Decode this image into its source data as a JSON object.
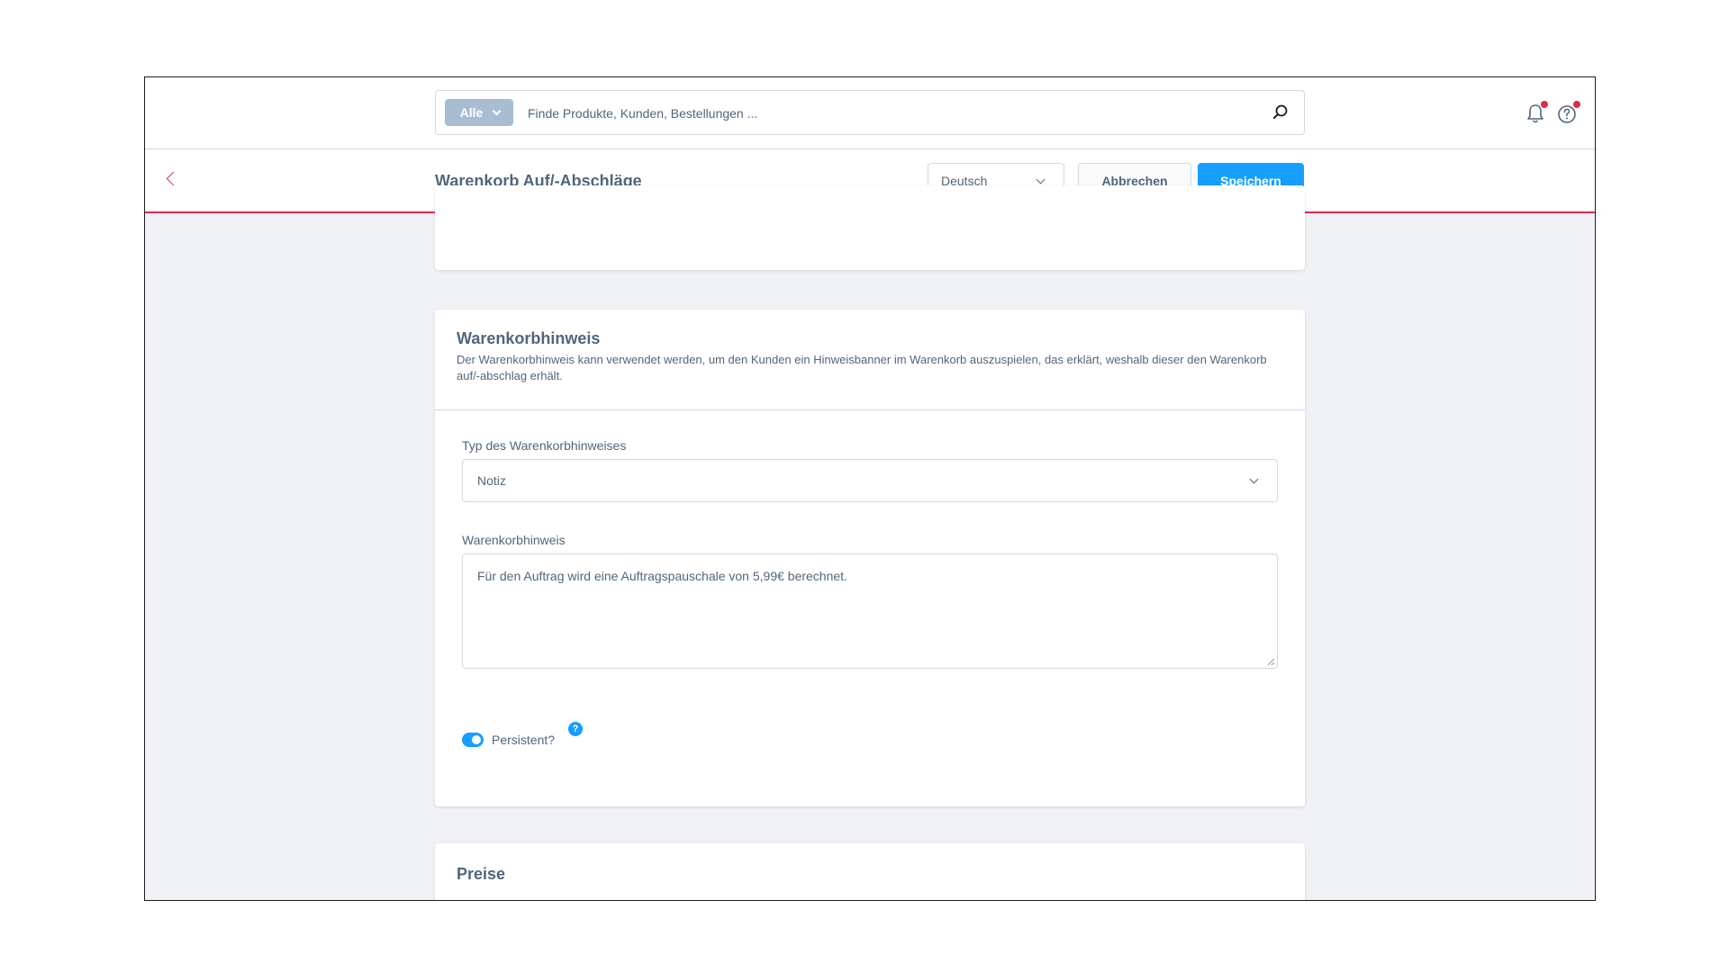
{
  "search": {
    "type_label": "Alle",
    "placeholder": "Finde Produkte, Kunden, Bestellungen ..."
  },
  "header": {
    "title": "Warenkorb Auf/-Abschläge",
    "language": "Deutsch",
    "cancel_label": "Abbrechen",
    "save_label": "Speichern"
  },
  "cart_notice": {
    "title": "Warenkorbhinweis",
    "description": "Der Warenkorbhinweis kann verwendet werden, um den Kunden ein Hinweisbanner im Warenkorb auszuspielen, das erklärt, weshalb dieser den Warenkorb auf/-abschlag erhält.",
    "type_label": "Typ des Warenkorbhinweises",
    "type_value": "Notiz",
    "notice_label": "Warenkorbhinweis",
    "notice_value": "Für den Auftrag wird eine Auftragspauschale von 5,99€ berechnet.",
    "persistent_label": "Persistent?",
    "persistent_on": true,
    "help_glyph": "?"
  },
  "prices": {
    "title": "Preise"
  },
  "colors": {
    "accent": "#189eff",
    "danger": "#de294c",
    "text": "#52667a",
    "border": "#d1d9e0"
  },
  "icons": [
    "search-icon",
    "bell-icon",
    "help-icon",
    "back-arrow-icon",
    "chevron-down-icon"
  ]
}
